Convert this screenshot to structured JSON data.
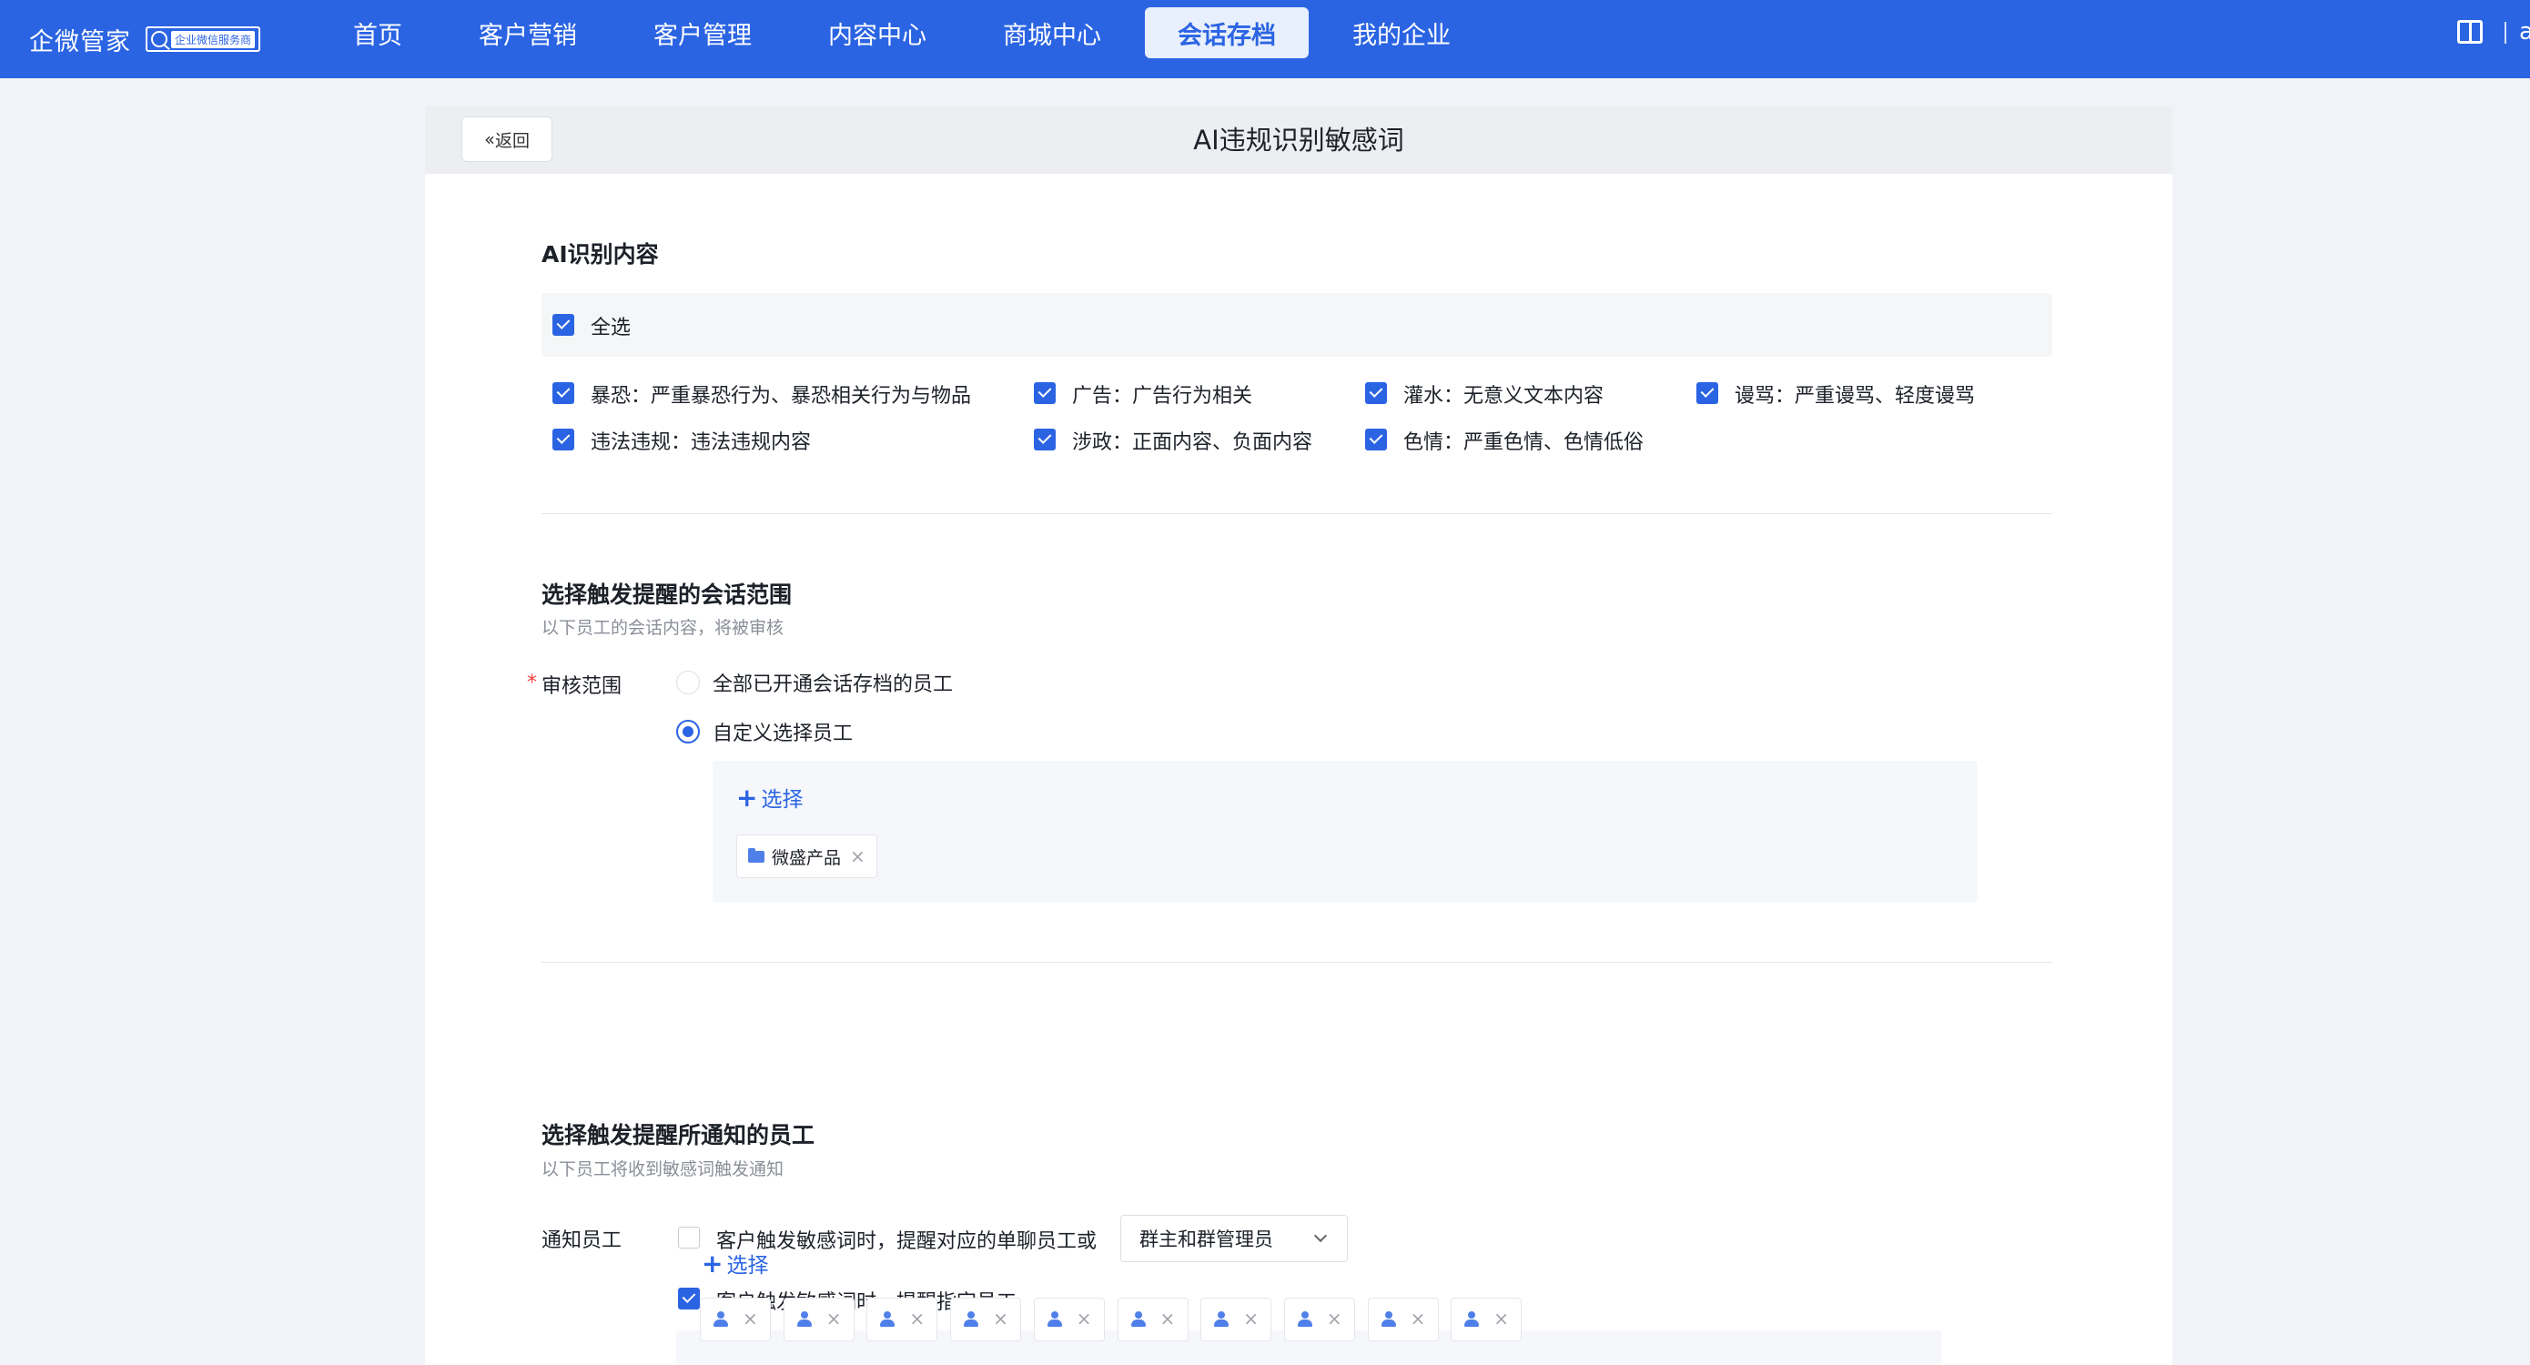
{
  "brand": {
    "name": "企微管家",
    "badge": "企业微信服务商"
  },
  "nav": [
    {
      "label": "首页",
      "active": false
    },
    {
      "label": "客户营销",
      "active": false
    },
    {
      "label": "客户管理",
      "active": false
    },
    {
      "label": "内容中心",
      "active": false
    },
    {
      "label": "商城中心",
      "active": false
    },
    {
      "label": "会话存档",
      "active": true
    },
    {
      "label": "我的企业",
      "active": false
    }
  ],
  "topbar": {
    "book_icon": "book-icon",
    "user_initial": "a"
  },
  "header": {
    "back_label": "返回",
    "title": "AI违规识别敏感词"
  },
  "section1": {
    "title": "AI识别内容",
    "select_all": {
      "label": "全选",
      "checked": true
    },
    "categories": [
      {
        "label": "暴恐：严重暴恐行为、暴恐相关行为与物品",
        "checked": true
      },
      {
        "label": "广告：广告行为相关",
        "checked": true
      },
      {
        "label": "灌水：无意义文本内容",
        "checked": true
      },
      {
        "label": "谩骂：严重谩骂、轻度谩骂",
        "checked": true
      },
      {
        "label": "违法违规：违法违规内容",
        "checked": true
      },
      {
        "label": "涉政：正面内容、负面内容",
        "checked": true
      },
      {
        "label": "色情：严重色情、色情低俗",
        "checked": true
      }
    ]
  },
  "section2": {
    "title": "选择触发提醒的会话范围",
    "subtitle": "以下员工的会话内容，将被审核",
    "field_label": "审核范围",
    "required_mark": "*",
    "options": [
      {
        "label": "全部已开通会话存档的员工",
        "selected": false
      },
      {
        "label": "自定义选择员工",
        "selected": true
      }
    ],
    "add_label": "选择",
    "tags": [
      {
        "label": "微盛产品",
        "icon": "folder-icon"
      }
    ]
  },
  "section3": {
    "title": "选择触发提醒所通知的员工",
    "subtitle": "以下员工将收到敏感词触发通知",
    "field_label": "通知员工",
    "option1": {
      "label": "客户触发敏感词时，提醒对应的单聊员工或",
      "checked": false,
      "dropdown_value": "群主和群管理员"
    },
    "option2": {
      "label": "客户触发敏感词时，提醒指定员工",
      "checked": true
    },
    "add_label": "选择",
    "user_tag_count": 10
  }
}
